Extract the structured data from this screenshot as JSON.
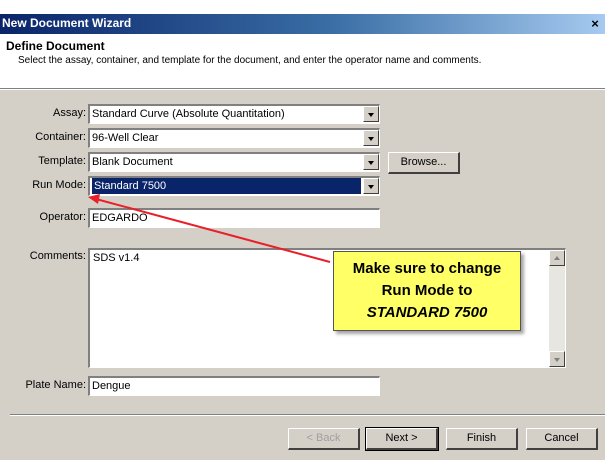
{
  "window": {
    "title": "New Document Wizard",
    "close_glyph": "×"
  },
  "header": {
    "title": "Define Document",
    "description": "Select the assay, container, and template for the document, and enter the operator name and comments."
  },
  "form": {
    "assay": {
      "label": "Assay:",
      "value": "Standard Curve (Absolute Quantitation)"
    },
    "container": {
      "label": "Container:",
      "value": "96-Well Clear"
    },
    "template": {
      "label": "Template:",
      "value": "Blank Document",
      "browse_label": "Browse..."
    },
    "run_mode": {
      "label": "Run Mode:",
      "value": "Standard 7500"
    },
    "operator": {
      "label": "Operator:",
      "value": "EDGARDO"
    },
    "comments": {
      "label": "Comments:",
      "value": "SDS v1.4"
    },
    "plate_name": {
      "label": "Plate Name:",
      "value": "Dengue"
    }
  },
  "buttons": {
    "back": "< Back",
    "next": "Next >",
    "finish": "Finish",
    "cancel": "Cancel"
  },
  "callout": {
    "line1": "Make sure to change",
    "line2": "Run Mode to",
    "line3": "STANDARD 7500",
    "color": "#ffff66"
  },
  "colors": {
    "titlebar": "#0a246a",
    "selection": "#0a246a",
    "arrow": "#e8202a",
    "dialog_face": "#d4d0c8"
  }
}
